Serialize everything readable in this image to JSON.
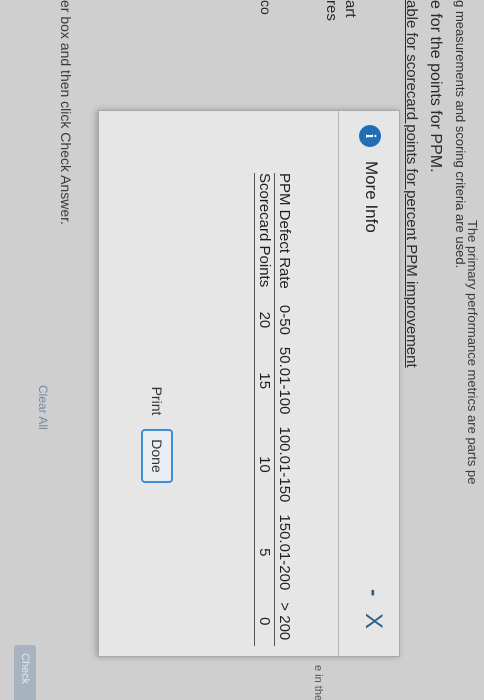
{
  "background": {
    "top_fragment": "ing measurements and scoring criteria are used.",
    "metrics_fragment": "The primary performance metrics are parts pe",
    "ppm_heading": "e for the points for PPM.",
    "table_heading": "able for scorecard points for percent PPM improvement",
    "left_fragments": [
      "art",
      "res",
      "co"
    ],
    "answer_instruction": "er box and then click Check Answer.",
    "clear_all": "Clear All",
    "right_fragment": "e in the p",
    "check_answer": "Check"
  },
  "modal": {
    "title": "More Info",
    "info_icon_glyph": "i",
    "minimize_glyph": "-",
    "close_glyph": "X",
    "table": {
      "rows": [
        {
          "label": "PPM Defect Rate",
          "cells": [
            "0-50",
            "50.01-100",
            "100.01-150",
            "150.01-200",
            "> 200"
          ]
        },
        {
          "label": "Scorecard Points",
          "cells": [
            "20",
            "15",
            "10",
            "5",
            "0"
          ]
        }
      ]
    },
    "print_label": "Print",
    "done_label": "Done"
  },
  "colors": {
    "info_icon": "#1f6fb6",
    "close_icon": "#2f5d8a",
    "done_border": "#3d8ed8"
  }
}
